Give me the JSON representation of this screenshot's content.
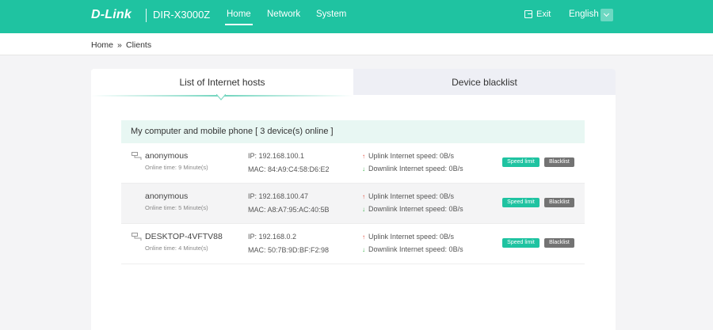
{
  "header": {
    "logo": "D-Link",
    "model": "DIR-X3000Z",
    "nav": [
      "Home",
      "Network",
      "System"
    ],
    "exit_label": "Exit",
    "language": "English"
  },
  "breadcrumb": {
    "home": "Home",
    "sep": "»",
    "current": "Clients"
  },
  "tabs": {
    "hosts": "List of Internet hosts",
    "blacklist": "Device blacklist"
  },
  "group_title": "My computer and mobile phone [ 3 device(s) online ]",
  "devices": [
    {
      "name": "anonymous",
      "online": "Online time: 9 Minute(s)",
      "ip": "IP:   192.168.100.1",
      "mac": "MAC:   84:A9:C4:58:D6:E2",
      "uplink": "Uplink Internet speed:  0B/s",
      "downlink": "Downlink Internet speed:   0B/s",
      "speed_limit": "Speed limit",
      "blacklist": "Blacklist"
    },
    {
      "name": "anonymous",
      "online": "Online time: 5 Minute(s)",
      "ip": "IP:   192.168.100.47",
      "mac": "MAC:   A8:A7:95:AC:40:5B",
      "uplink": "Uplink Internet speed:  0B/s",
      "downlink": "Downlink Internet speed:   0B/s",
      "speed_limit": "Speed limit",
      "blacklist": "Blacklist"
    },
    {
      "name": "DESKTOP-4VFTV88",
      "online": "Online time: 4 Minute(s)",
      "ip": "IP:   192.168.0.2",
      "mac": "MAC:   50:7B:9D:BF:F2:98",
      "uplink": "Uplink Internet speed:  0B/s",
      "downlink": "Downlink Internet speed:   0B/s",
      "speed_limit": "Speed limit",
      "blacklist": "Blacklist"
    }
  ],
  "icons": {
    "device": "ethernet-device-icon",
    "up": "uplink-arrow-icon",
    "down": "downlink-arrow-icon"
  },
  "colors": {
    "accent": "#1fc3a1",
    "blacklist_btn": "#737373",
    "up": "#e24a3b",
    "down": "#3fb34f"
  }
}
